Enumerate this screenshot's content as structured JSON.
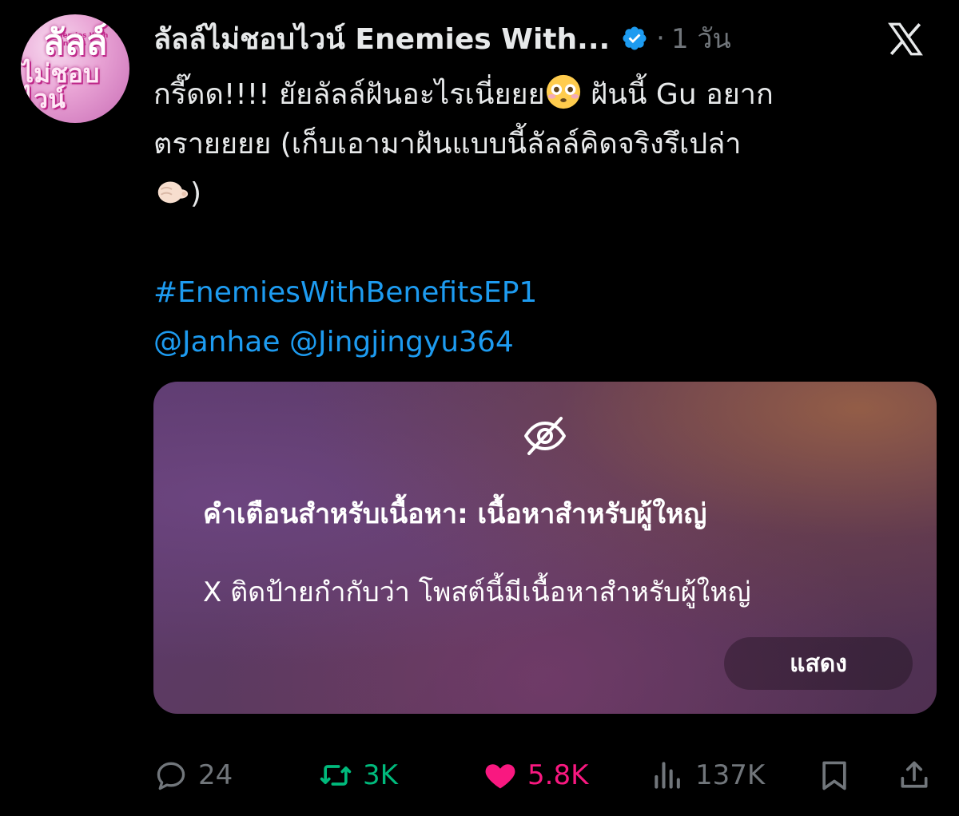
{
  "tweet": {
    "author": {
      "display_name": "ลัลล์ไม่ชอบไวน์ Enemies With...",
      "verified": true,
      "avatar": {
        "line1": "ลัลล์",
        "line2": "ไม่ชอบไวน์",
        "small_text": "Enemies With Benefits"
      }
    },
    "separator": "·",
    "time": "1 วัน",
    "text_lines": {
      "line1_a": "กรี๊ดด!!!! ยัยลัลล์ฝันอะไรเนี่ยยย",
      "line1_b": " ฝันนี้ Gu อยาก",
      "line2": "ตรายยยย (เก็บเอามาฝันแบบนี้ลัลล์คิดจริงรึเปล่า",
      "line3": ")"
    },
    "emojis": [
      "flushed-face",
      "backhand-pointing-emoji"
    ],
    "hashtag": "#EnemiesWithBenefitsEP1",
    "mentions": "@Janhae @Jingjingyu364",
    "content_warning": {
      "title": "คำเตือนสำหรับเนื้อหา: เนื้อหาสำหรับผู้ใหญ่",
      "description": "X ติดป้ายกำกับว่า โพสต์นี้มีเนื้อหาสำหรับผู้ใหญ่",
      "button_label": "แสดง"
    },
    "stats": {
      "replies": "24",
      "reposts": "3K",
      "likes": "5.8K",
      "views": "137K"
    }
  },
  "colors": {
    "background": "#000000",
    "text": "#e7e9ea",
    "muted": "#71767b",
    "link": "#1d9bf0",
    "repost": "#00ba7c",
    "like": "#f91880",
    "verified": "#1d9bf0"
  },
  "icons": [
    "x-logo-icon",
    "verified-badge-icon",
    "eye-slash-icon",
    "reply-icon",
    "repost-icon",
    "heart-icon",
    "views-icon",
    "bookmark-icon",
    "share-icon"
  ]
}
